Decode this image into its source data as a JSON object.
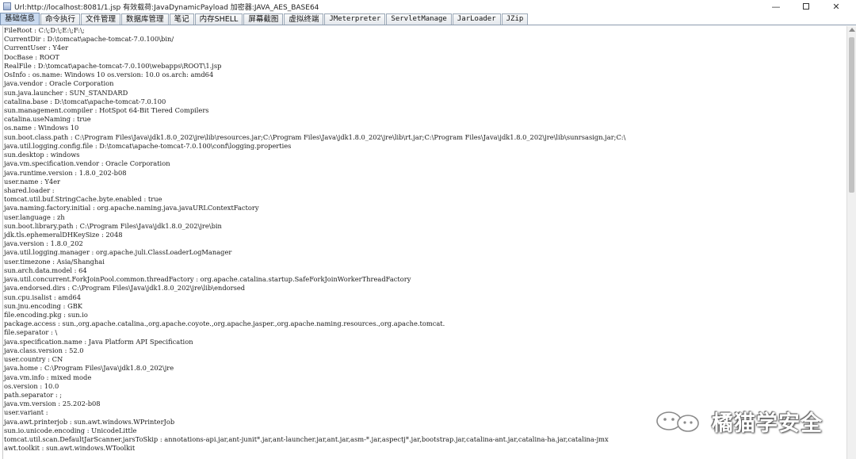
{
  "window": {
    "title": "Url:http://localhost:8081/1.jsp 有效载荷:JavaDynamicPayload 加密器:JAVA_AES_BASE64",
    "controls": [
      "minimize",
      "maximize",
      "close"
    ]
  },
  "tabs": [
    {
      "label": "基础信息",
      "active": true,
      "mono": false
    },
    {
      "label": "命令执行",
      "active": false,
      "mono": false
    },
    {
      "label": "文件管理",
      "active": false,
      "mono": false
    },
    {
      "label": "数据库管理",
      "active": false,
      "mono": false
    },
    {
      "label": "笔记",
      "active": false,
      "mono": false
    },
    {
      "label": "内存SHELL",
      "active": false,
      "mono": false
    },
    {
      "label": "屏幕截图",
      "active": false,
      "mono": false
    },
    {
      "label": "虚拟终端",
      "active": false,
      "mono": false
    },
    {
      "label": "JMeterpreter",
      "active": false,
      "mono": true
    },
    {
      "label": "ServletManage",
      "active": false,
      "mono": true
    },
    {
      "label": "JarLoader",
      "active": false,
      "mono": true
    },
    {
      "label": "JZip",
      "active": false,
      "mono": true
    }
  ],
  "info_lines": [
    "FileRoot : C:\\;D:\\;E:\\;F:\\;",
    "CurrentDir : D:\\tomcat\\apache-tomcat-7.0.100\\bin/",
    "CurrentUser : Y4er",
    "DocBase : ROOT",
    "RealFile : D:\\tomcat\\apache-tomcat-7.0.100\\webapps\\ROOT\\1.jsp",
    "OsInfo : os.name: Windows 10 os.version: 10.0 os.arch: amd64",
    "java.vendor : Oracle Corporation",
    "sun.java.launcher : SUN_STANDARD",
    "catalina.base : D:\\tomcat\\apache-tomcat-7.0.100",
    "sun.management.compiler : HotSpot 64-Bit Tiered Compilers",
    "catalina.useNaming : true",
    "os.name : Windows 10",
    "sun.boot.class.path : C:\\Program Files\\Java\\jdk1.8.0_202\\jre\\lib\\resources.jar;C:\\Program Files\\Java\\jdk1.8.0_202\\jre\\lib\\rt.jar;C:\\Program Files\\Java\\jdk1.8.0_202\\jre\\lib\\sunrsasign.jar;C:\\",
    "java.util.logging.config.file : D:\\tomcat\\apache-tomcat-7.0.100\\conf\\logging.properties",
    "sun.desktop : windows",
    "java.vm.specification.vendor : Oracle Corporation",
    "java.runtime.version : 1.8.0_202-b08",
    "user.name : Y4er",
    "shared.loader :",
    "tomcat.util.buf.StringCache.byte.enabled : true",
    "java.naming.factory.initial : org.apache.naming.java.javaURLContextFactory",
    "user.language : zh",
    "sun.boot.library.path : C:\\Program Files\\Java\\jdk1.8.0_202\\jre\\bin",
    "jdk.tls.ephemeralDHKeySize : 2048",
    "java.version : 1.8.0_202",
    "java.util.logging.manager : org.apache.juli.ClassLoaderLogManager",
    "user.timezone : Asia/Shanghai",
    "sun.arch.data.model : 64",
    "java.util.concurrent.ForkJoinPool.common.threadFactory : org.apache.catalina.startup.SafeForkJoinWorkerThreadFactory",
    "java.endorsed.dirs : C:\\Program Files\\Java\\jdk1.8.0_202\\jre\\lib\\endorsed",
    "sun.cpu.isalist : amd64",
    "sun.jnu.encoding : GBK",
    "file.encoding.pkg : sun.io",
    "package.access : sun.,org.apache.catalina.,org.apache.coyote.,org.apache.jasper.,org.apache.naming.resources.,org.apache.tomcat.",
    "file.separator : \\",
    "java.specification.name : Java Platform API Specification",
    "java.class.version : 52.0",
    "user.country : CN",
    "java.home : C:\\Program Files\\Java\\jdk1.8.0_202\\jre",
    "java.vm.info : mixed mode",
    "os.version : 10.0",
    "path.separator : ;",
    "java.vm.version : 25.202-b08",
    "user.variant :",
    "java.awt.printerjob : sun.awt.windows.WPrinterJob",
    "sun.io.unicode.encoding : UnicodeLittle",
    "tomcat.util.scan.DefaultJarScanner.jarsToSkip : annotations-api.jar,ant-junit*.jar,ant-launcher.jar,ant.jar,asm-*.jar,aspectj*.jar,bootstrap.jar,catalina-ant.jar,catalina-ha.jar,catalina-jmx",
    "awt.toolkit : sun.awt.windows.WToolkit"
  ],
  "watermark": {
    "text": "橘猫学安全"
  }
}
